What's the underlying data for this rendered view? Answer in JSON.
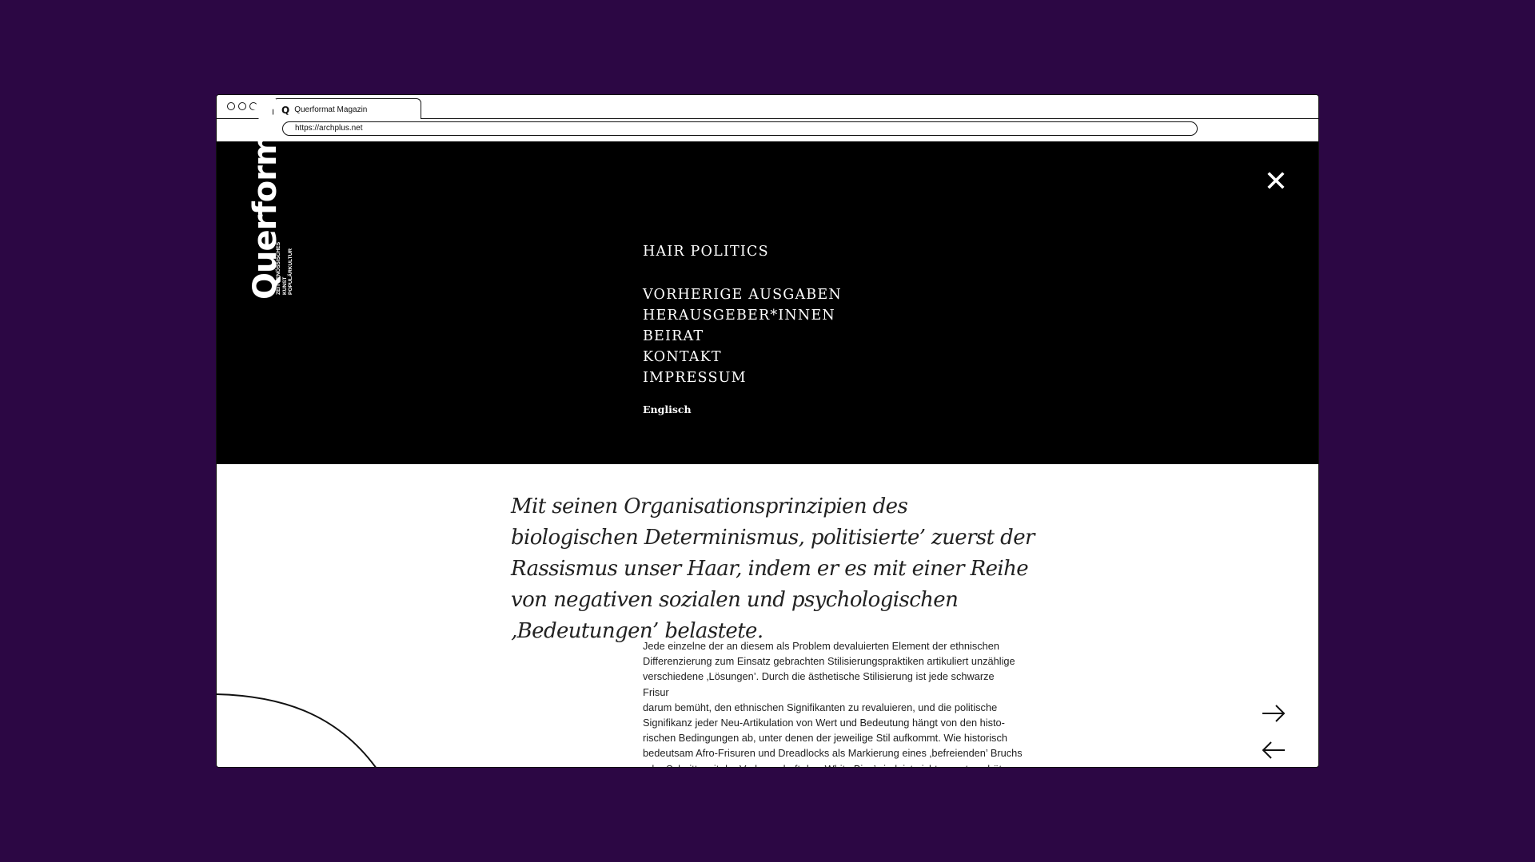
{
  "browser": {
    "tab_title": "Querformat Magazin",
    "tab_icon": "Q",
    "url": "https://archplus.net"
  },
  "logo": {
    "wordmark": "Querformat",
    "subtitle": [
      "ZEITGENÖSSISCHES",
      "KUNST",
      "POPULÄRKULTUR"
    ]
  },
  "menu": {
    "current_issue": "HAIR POLITICS",
    "items": [
      "VORHERIGE AUSGABEN",
      "HERAUSGEBER*INNEN",
      "BEIRAT",
      "KONTAKT",
      "IMPRESSUM"
    ],
    "language": "Englisch"
  },
  "article": {
    "quote": "Mit seinen Organisationsprinzipien des biologischen Determinismus, politisierte’ zuerst der Rassismus unser Haar, indem er es mit einer Reihe von negativen sozialen und psychologischen ‚Bedeutungen’ belastete.",
    "body_lines": [
      "Jede einzelne der an diesem als Problem devaluierten Element der ethnischen",
      "Differenzierung zum Einsatz gebrachten Stilisierungspraktiken artikuliert unzählige",
      "verschiedene ‚Lösungen’. Durch die ästhetische Stilisierung ist jede schwarze Frisur",
      "darum bemüht, den ethnischen Signifikanten zu revaluieren, und die politische",
      "Signifikanz jeder Neu-Artikulation von Wert und Bedeutung hängt von den histo-",
      "rischen Bedingungen ab, unter denen der jeweilige Stil aufkommt. Wie historisch",
      "bedeutsam Afro-Frisuren und Dreadlocks als Markierung eines ‚befreienden’ Bruchs",
      "oder Schnitts mit der Vorherrschaft des ‚White Bias’ sind, ist nicht zu unterschätzen."
    ]
  },
  "colors": {
    "background": "#2c0744",
    "menu_background": "#000000",
    "menu_text": "#ffffff"
  }
}
